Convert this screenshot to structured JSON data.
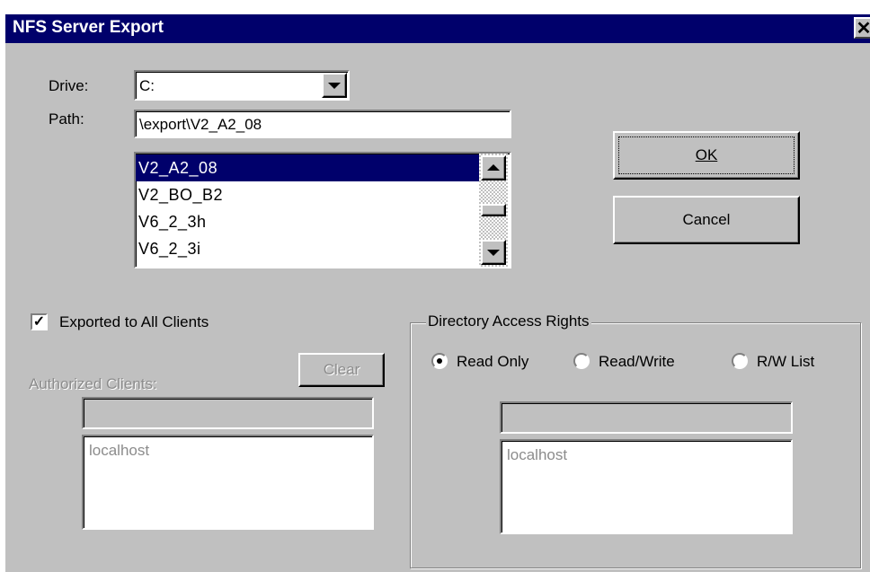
{
  "window": {
    "title": "NFS Server Export",
    "close_icon": "close-icon"
  },
  "drive": {
    "label": "Drive:",
    "value": "C:"
  },
  "path": {
    "label": "Path:",
    "value": "\\export\\V2_A2_08"
  },
  "directory_list": {
    "items": [
      "V2_A2_08",
      "V2_BO_B2",
      "V6_2_3h",
      "V6_2_3i"
    ],
    "selected_index": 0
  },
  "buttons": {
    "ok": "OK",
    "cancel": "Cancel",
    "clear": "Clear"
  },
  "export_all": {
    "label": "Exported to All Clients",
    "checked": true
  },
  "authorized": {
    "label": "Authorized  Clients:",
    "input_value": "",
    "list_items": [
      "localhost"
    ]
  },
  "access_rights": {
    "group_label": "Directory Access Rights",
    "options": [
      "Read Only",
      "Read/Write",
      "R/W List"
    ],
    "selected": "Read Only",
    "input_value": "",
    "list_items": [
      "localhost"
    ]
  },
  "colors": {
    "titlebar": "#00006b",
    "face": "#c0c0c0",
    "selection": "#00006b"
  }
}
